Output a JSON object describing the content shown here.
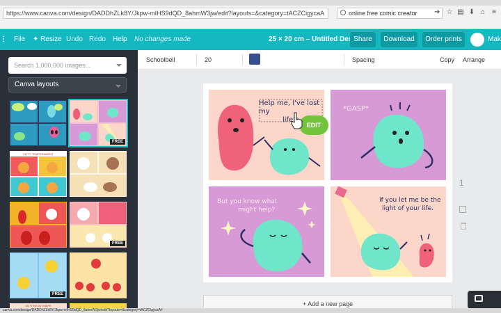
{
  "browser": {
    "url": "https://www.canva.com/design/DADDhZLk8Y/Jkpw-mIHS9dQD_8ahmW3jw/edit?layouts=&category=tACZCigycaA",
    "search_query": "online free comic creator"
  },
  "topbar": {
    "file": "File",
    "resize": "Resize",
    "undo": "Undo",
    "redo": "Redo",
    "help": "Help",
    "status": "No changes made",
    "design_title": "25 × 20 cm – Untitled Design",
    "share": "Share",
    "download": "Download",
    "order_prints": "Order prints",
    "make_partial": "Make"
  },
  "sidebar": {
    "search_placeholder": "Search 1,000,000 images...",
    "layout_select": "Canva layouts",
    "free_badge": "FREE",
    "thumb_titles": [
      "KITTY TEMPERAMENT",
      "GETTING IN SHAPE"
    ]
  },
  "toolbar": {
    "font_name": "Schoolbell",
    "font_size": "20",
    "spacing": "Spacing",
    "copy": "Copy",
    "arrange": "Arrange",
    "text_color": "#364f8e"
  },
  "comic": {
    "panel1_text": "Help me, I've lost my life's",
    "panel1_text_line1": "Help me, I've lost my",
    "panel1_text_line2": "life's",
    "edit_label": "EDIT",
    "panel2_text": "*GASP*",
    "panel3_line1": "But you know what",
    "panel3_line2": "might help?",
    "panel4_line1": "If you let me be the",
    "panel4_line2": "light of your life."
  },
  "canvas": {
    "page_number": "1",
    "add_page": "+ Add a new page"
  },
  "status_url": "canva.com/design/DADDhZLk8Y/Jkpw-mIHS9dQD_8ahmW3jw/edit?layouts=&category=tACZCigycaA#"
}
